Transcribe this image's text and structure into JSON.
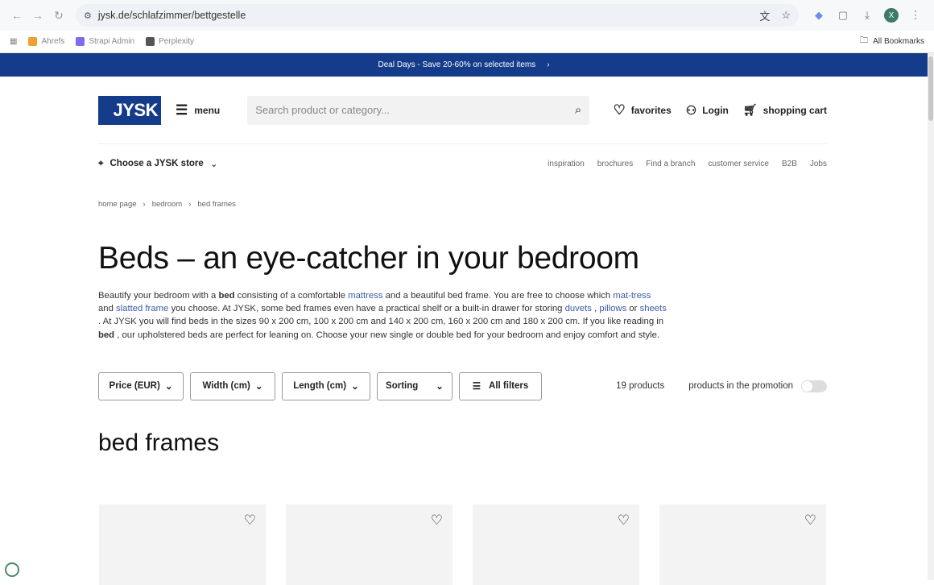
{
  "browser": {
    "url": "jysk.de/schlafzimmer/bettgestelle",
    "bookmarks": [
      "Ahrefs",
      "Strapi Admin",
      "Perplexity"
    ],
    "all_bookmarks": "All Bookmarks",
    "avatar": "X"
  },
  "promo": {
    "text": "Deal Days - Save 20-60% on selected items"
  },
  "header": {
    "logo": "JYSK",
    "menu": "menu",
    "search_placeholder": "Search product or category...",
    "favorites": "favorites",
    "login": "Login",
    "cart": "shopping cart"
  },
  "subnav": {
    "store": "Choose a JYSK store",
    "links": [
      "inspiration",
      "brochures",
      "Find a branch",
      "customer service",
      "B2B",
      "Jobs"
    ]
  },
  "breadcrumb": [
    "home page",
    "bedroom",
    "bed frames"
  ],
  "title": "Beds – an eye-catcher in your bedroom",
  "description": {
    "segments": [
      "Beautify your bedroom with a ",
      "bed",
      " consisting of a comfortable ",
      "mattress",
      "  and a beautiful bed frame. You are free to choose which ",
      "mat-tress",
      "  and ",
      "slatted frame",
      "  you choose. At JYSK, some bed frames even have a practical shelf or a built-in drawer for storing ",
      "duvets",
      " , ",
      "pillows",
      " or ",
      "sheets",
      " . At JYSK you will find beds in the sizes 90 x 200 cm, 100 x 200 cm and 140 x 200 cm, 160 x 200 cm and 180 x 200 cm. If you like reading in ",
      "bed",
      " , our upholstered beds are perfect for leaning on. Choose your new single or double bed for your bedroom and enjoy comfort and style."
    ]
  },
  "filters": {
    "price": "Price (EUR)",
    "width": "Width (cm)",
    "length": "Length (cm)",
    "sorting": "Sorting",
    "all": "All filters",
    "count": "19 products",
    "promotion": "products in the promotion",
    "promotion_on": false
  },
  "section_title": "bed frames",
  "colors": {
    "brand": "#143c8a",
    "link": "#3a5ca8"
  }
}
